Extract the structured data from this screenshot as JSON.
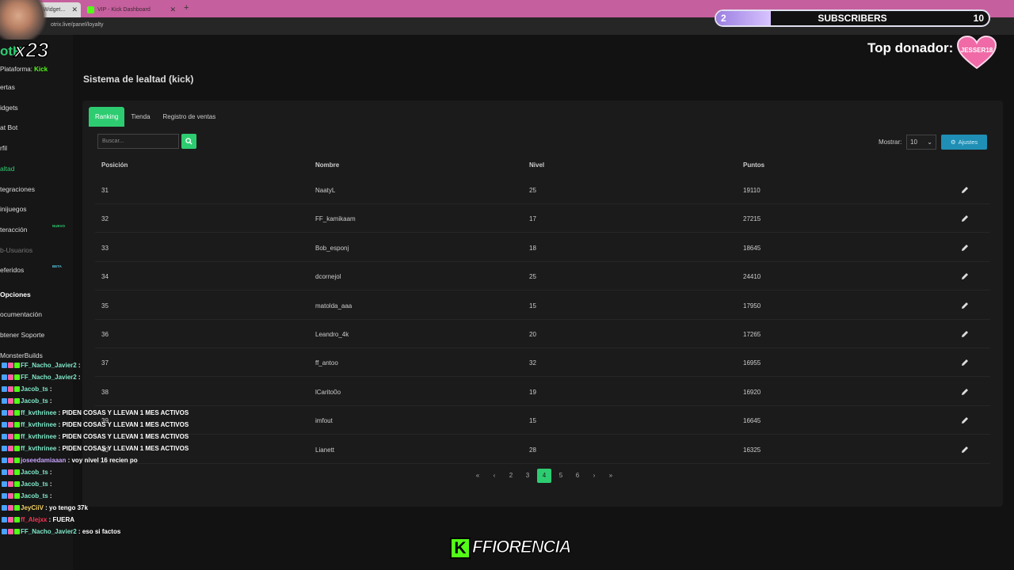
{
  "browser": {
    "tabs": [
      {
        "label": "The best ... and Widget...",
        "active": true
      },
      {
        "label": "VIP - Kick Dashboard",
        "active": false
      }
    ],
    "url": "otrix.live/panel/loyalty"
  },
  "overlay": {
    "subscribers": {
      "current": "2",
      "title": "SUBSCRIBERS",
      "goal": "10",
      "progress": 0.2
    },
    "top_donor_label": "Top donador:",
    "top_donor_name": "JESSER18",
    "multiplier": "x23",
    "footer_brand": "FFIORENCIA",
    "footer_k": "K"
  },
  "app": {
    "logo": "otR",
    "platform_label": "Plataforma:",
    "platform_value": "Kick",
    "menu": [
      {
        "label": "ertas"
      },
      {
        "label": "idgets"
      },
      {
        "label": "at Bot"
      },
      {
        "label": "rfil"
      },
      {
        "label": "altad",
        "active": true
      },
      {
        "label": "tegraciones"
      },
      {
        "label": "inijuegos"
      },
      {
        "label": "teracción",
        "badge": "NUEVO"
      },
      {
        "label": "b-Usuarios",
        "dim": true
      },
      {
        "label": "eferidos",
        "badge": "BETA"
      },
      {
        "label": "Opciones",
        "bold": true
      },
      {
        "label": "ocumentación"
      },
      {
        "label": "btener Soporte"
      },
      {
        "label": "MonsterBuilds"
      }
    ]
  },
  "main": {
    "title": "Sistema de lealtad (kick)",
    "tabs": [
      "Ranking",
      "Tienda",
      "Registro de ventas"
    ],
    "search_placeholder": "Buscar...",
    "show_label": "Mostrar:",
    "show_value": "10",
    "settings_label": "Ajustes",
    "columns": [
      "Posición",
      "Nombre",
      "Nivel",
      "Puntos"
    ],
    "rows": [
      {
        "pos": "31",
        "name": "NaatyL",
        "level": "25",
        "points": "19110"
      },
      {
        "pos": "32",
        "name": "FF_kamikaam",
        "level": "17",
        "points": "27215"
      },
      {
        "pos": "33",
        "name": "Bob_esponj",
        "level": "18",
        "points": "18645"
      },
      {
        "pos": "34",
        "name": "dcornejol",
        "level": "25",
        "points": "24410"
      },
      {
        "pos": "35",
        "name": "matolda_aaa",
        "level": "15",
        "points": "17950"
      },
      {
        "pos": "36",
        "name": "Leandro_4k",
        "level": "20",
        "points": "17265"
      },
      {
        "pos": "37",
        "name": "ff_antoo",
        "level": "32",
        "points": "16955"
      },
      {
        "pos": "38",
        "name": "lCarito0o",
        "level": "19",
        "points": "16920"
      },
      {
        "pos": "39",
        "name": "imfout",
        "level": "15",
        "points": "16645"
      },
      {
        "pos": "40",
        "name": "Lianett",
        "level": "28",
        "points": "16325"
      }
    ],
    "pagination": [
      "«",
      "‹",
      "2",
      "3",
      "4",
      "5",
      "6",
      "›",
      "»"
    ],
    "current_page": "4"
  },
  "chat": [
    {
      "user": "FF_Nacho_Javier2",
      "msg": "",
      "color": "teal"
    },
    {
      "user": "FF_Nacho_Javier2",
      "msg": "",
      "color": "teal"
    },
    {
      "user": "Jacob_ts",
      "msg": "",
      "color": "teal"
    },
    {
      "user": "Jacob_ts",
      "msg": "",
      "color": "teal"
    },
    {
      "user": "ff_kvthrinee",
      "msg": "PIDEN COSAS Y LLEVAN 1 MES ACTIVOS",
      "color": "teal"
    },
    {
      "user": "ff_kvthrinee",
      "msg": "PIDEN COSAS Y LLEVAN 1 MES ACTIVOS",
      "color": "teal"
    },
    {
      "user": "ff_kvthrinee",
      "msg": "PIDEN COSAS Y LLEVAN 1 MES ACTIVOS",
      "color": "teal"
    },
    {
      "user": "ff_kvthrinee",
      "msg": "PIDEN COSAS Y LLEVAN 1 MES ACTIVOS",
      "color": "teal"
    },
    {
      "user": "joseedamiaaan",
      "msg": "voy nivel 16 recien po",
      "color": "purple"
    },
    {
      "user": "Jacob_ts",
      "msg": "",
      "color": "teal"
    },
    {
      "user": "Jacob_ts",
      "msg": "",
      "color": "teal"
    },
    {
      "user": "Jacob_ts",
      "msg": "",
      "color": "teal"
    },
    {
      "user": "JeyCiiV",
      "msg": "yo tengo 37k",
      "color": "gold"
    },
    {
      "user": "ff_Alejxx",
      "msg": "FUERA",
      "color": "red"
    },
    {
      "user": "FF_Nacho_Javier2",
      "msg": "eso si factos",
      "color": "teal"
    }
  ],
  "colors": {
    "accent": "#2ecc71",
    "kick": "#53fc18",
    "info": "#1f8fb5",
    "tabbar": "#c65f9d"
  }
}
